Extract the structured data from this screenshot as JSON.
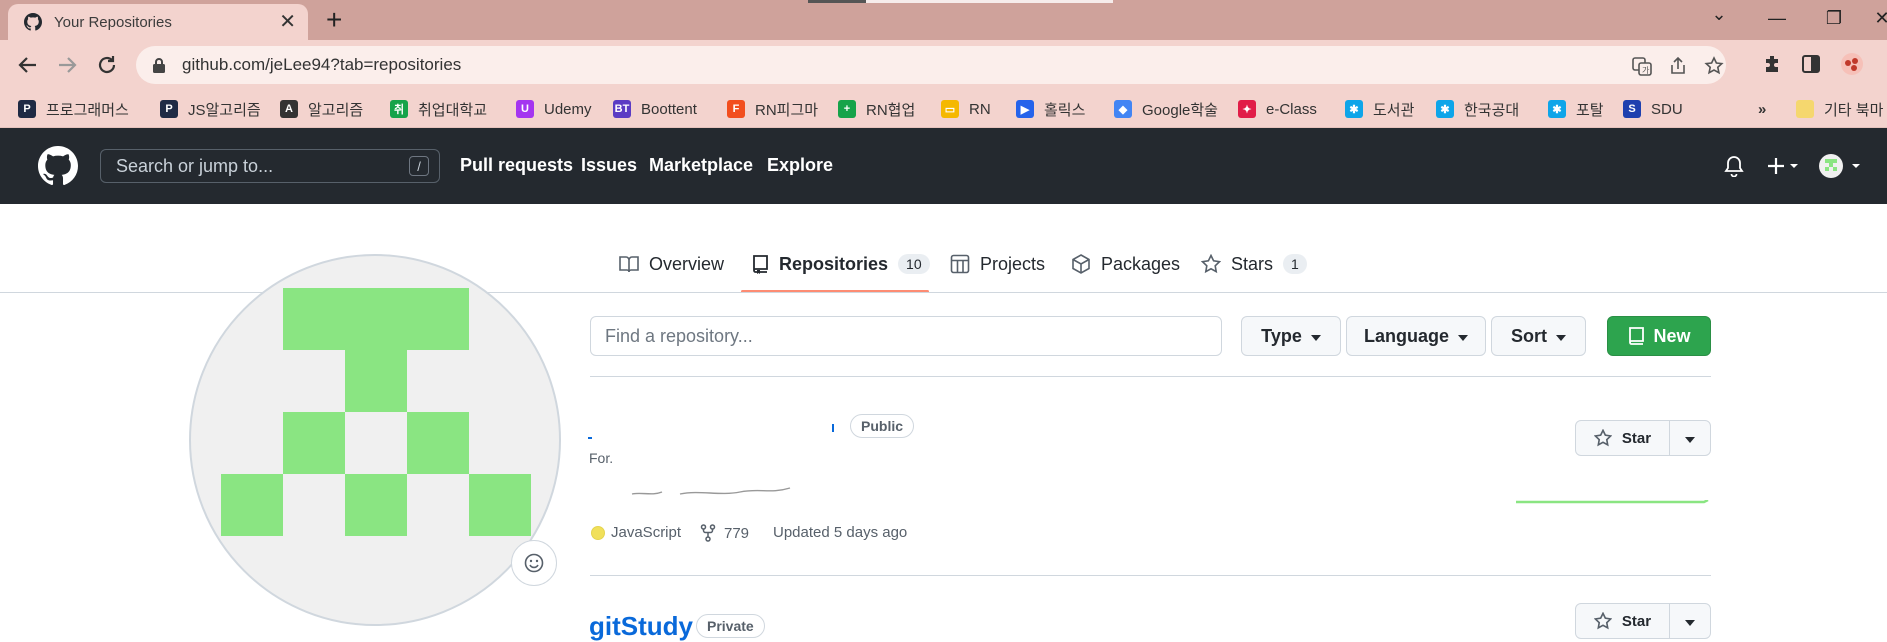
{
  "browser": {
    "tab_title": "Your Repositories",
    "url": "github.com/jeLee94?tab=repositories",
    "bookmarks": [
      {
        "label": "프로그래머스",
        "color": "#1f2a44",
        "glyph": "P"
      },
      {
        "label": "JS알고리즘",
        "color": "#1f2a44",
        "glyph": "P"
      },
      {
        "label": "알고리즘",
        "color": "#333333",
        "glyph": "A"
      },
      {
        "label": "취업대학교",
        "color": "#16a34a",
        "glyph": "취"
      },
      {
        "label": "Udemy",
        "color": "#a435f0",
        "glyph": "U"
      },
      {
        "label": "Boottent",
        "color": "#5b3cc4",
        "glyph": "BT"
      },
      {
        "label": "RN피그마",
        "color": "#f24e1e",
        "glyph": "F"
      },
      {
        "label": "RN협업",
        "color": "#16a34a",
        "glyph": "+"
      },
      {
        "label": "RN",
        "color": "#f5b800",
        "glyph": "▭"
      },
      {
        "label": "홀릭스",
        "color": "#2563eb",
        "glyph": "▶"
      },
      {
        "label": "Google학술",
        "color": "#4285f4",
        "glyph": "◆"
      },
      {
        "label": "e-Class",
        "color": "#e11d48",
        "glyph": "✦"
      },
      {
        "label": "도서관",
        "color": "#0ea5e9",
        "glyph": "✱"
      },
      {
        "label": "한국공대",
        "color": "#0ea5e9",
        "glyph": "✱"
      },
      {
        "label": "포탈",
        "color": "#0ea5e9",
        "glyph": "✱"
      },
      {
        "label": "SDU",
        "color": "#1e40af",
        "glyph": "S"
      }
    ],
    "overflow_label": "»",
    "other_bookmarks_label": "기타 북마"
  },
  "github": {
    "search_placeholder": "Search or jump to...",
    "search_shortcut": "/",
    "nav": [
      "Pull requests",
      "Issues",
      "Marketplace",
      "Explore"
    ]
  },
  "profile_tabs": {
    "overview": "Overview",
    "repositories": "Repositories",
    "repositories_count": "10",
    "projects": "Projects",
    "packages": "Packages",
    "stars": "Stars",
    "stars_count": "1"
  },
  "filters": {
    "find_placeholder": "Find a repository...",
    "type": "Type",
    "language": "Language",
    "sort": "Sort",
    "new": "New"
  },
  "repos": [
    {
      "name": "",
      "visibility": "Public",
      "forked_from": "For.",
      "language": "JavaScript",
      "language_color": "#f1e05a",
      "forks": "779",
      "updated": "Updated 5 days ago",
      "star_label": "Star"
    },
    {
      "name": "gitStudy",
      "visibility": "Private",
      "star_label": "Star"
    }
  ],
  "colors": {
    "tabstrip": "#cfa29b",
    "toolbar": "#f3d3ce",
    "github_header": "#24292f",
    "accent_underline": "#fd8c73",
    "new_button": "#2da44e",
    "avatar_green": "#8ae582",
    "link_blue": "#0969da"
  }
}
